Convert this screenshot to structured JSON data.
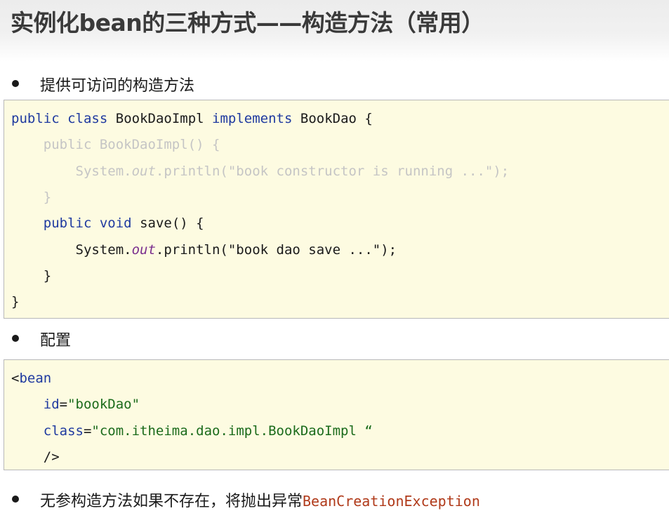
{
  "title": "实例化bean的三种方式——构造方法（常用）",
  "bullets": {
    "b1": "提供可访问的构造方法",
    "b2": "配置",
    "b3_prefix": "无参构造方法如果不存在，将抛出异常",
    "b3_exception": "BeanCreationException"
  },
  "java": {
    "l1_kw1": "public",
    "l1_kw2": "class",
    "l1_name": "BookDaoImpl",
    "l1_kw3": "implements",
    "l1_rest": "BookDao {",
    "l2": "public BookDaoImpl() {",
    "l3_a": "System.",
    "l3_out": "out",
    "l3_b": ".println(\"book constructor is running ...\");",
    "l4": "}",
    "l5_kw1": "public",
    "l5_kw2": "void",
    "l5_rest": "save() {",
    "l6_a": "System.",
    "l6_out": "out",
    "l6_b": ".println(\"book dao save ...\");",
    "l7": "}",
    "l8": "}"
  },
  "xml": {
    "l1_lt": "<",
    "l1_tag": "bean",
    "l2_attr": "id",
    "l2_eq": "=",
    "l2_val": "\"bookDao\"",
    "l3_attr": "class",
    "l3_eq": "=",
    "l3_val": "\"com.itheima.dao.impl.BookDaoImpl “",
    "l4": "/>"
  }
}
